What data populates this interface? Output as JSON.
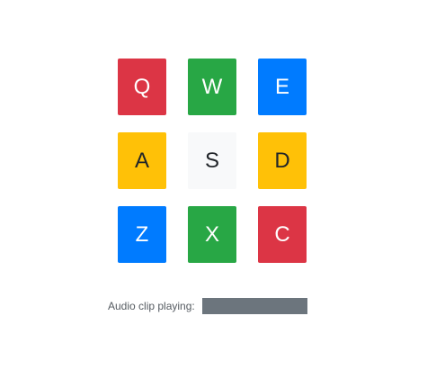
{
  "keypad": {
    "keys": [
      {
        "label": "Q",
        "bg": "#dc3545",
        "fg": "#ffffff"
      },
      {
        "label": "W",
        "bg": "#28a745",
        "fg": "#ffffff"
      },
      {
        "label": "E",
        "bg": "#007bff",
        "fg": "#ffffff"
      },
      {
        "label": "A",
        "bg": "#ffc107",
        "fg": "#212529"
      },
      {
        "label": "S",
        "bg": "#f8f9fa",
        "fg": "#212529"
      },
      {
        "label": "D",
        "bg": "#ffc107",
        "fg": "#212529"
      },
      {
        "label": "Z",
        "bg": "#007bff",
        "fg": "#ffffff"
      },
      {
        "label": "X",
        "bg": "#28a745",
        "fg": "#ffffff"
      },
      {
        "label": "C",
        "bg": "#dc3545",
        "fg": "#ffffff"
      }
    ]
  },
  "status": {
    "label": "Audio clip playing:",
    "bar_color": "#6c757d"
  }
}
